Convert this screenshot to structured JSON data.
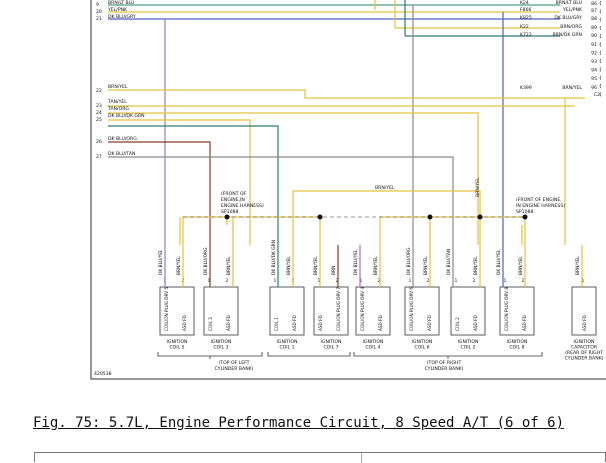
{
  "top_left_rows": [
    {
      "num": "9",
      "label": "BRN/LT BLU"
    },
    {
      "num": "20",
      "label": "YEL/PNK"
    },
    {
      "num": "21",
      "label": "DK BLU/GRY"
    }
  ],
  "left_rows": [
    {
      "num": "22",
      "label": "BRN/YEL"
    },
    {
      "num": "23",
      "label": "TAN/YEL"
    },
    {
      "num": "24",
      "label": "TAN/ORG"
    },
    {
      "num": "25",
      "label": "DK BLU/DK GRN"
    },
    {
      "num": "26",
      "label": "DK BLU/ORG"
    },
    {
      "num": "27",
      "label": "DK BLU/TAN"
    }
  ],
  "right_rows": [
    {
      "code": "K24",
      "label": "BRN/LT BLU",
      "pin": "86"
    },
    {
      "code": "F866",
      "label": "YEL/PNK",
      "pin": "87"
    },
    {
      "code": "K825",
      "label": "DK BLU/GRY",
      "pin": "88"
    },
    {
      "code": "K22",
      "label": "BRN/ORG",
      "pin": "89"
    },
    {
      "code": "K722",
      "label": "BRN/DK GRN",
      "pin": "90"
    }
  ],
  "right_pins_extra": [
    "91",
    "92",
    "93",
    "94",
    "95"
  ],
  "right_brn_yel": {
    "code": "K399",
    "label": "BRN/YEL",
    "pin": "96",
    "connector": "C2"
  },
  "brn_yel_top": "BRN/YEL",
  "brn_yel_vertical": "BRN/YEL",
  "splice_left": [
    "(FRONT OF",
    "ENGINE,IN",
    "ENGINE HARNESS)",
    "SP1088"
  ],
  "splice_right": [
    "(FRONT OF ENGINE,",
    "IN ENGINE HARNESS)",
    "SP1088"
  ],
  "wire_labels": [
    "DK BLU/YEL",
    "BRN/YEL",
    "DK BLU/ORG",
    "BRN/YEL",
    "DK BLU/DK GRN",
    "BRN/YEL",
    "BRN/YEL",
    "BRN",
    "DK BLU/YEL",
    "BRN/YEL",
    "DK BLU/ORG",
    "BRN/YEL",
    "DK BLU/TAN",
    "BRN/YEL",
    "DK BLU/YEL",
    "BRN/YEL",
    "BRN/YEL"
  ],
  "coils": [
    {
      "pins": [
        "COIL/ON PLUG DRV 5",
        "ASD FD"
      ],
      "name": [
        "IGNITION",
        "COIL 5"
      ]
    },
    {
      "pins": [
        "COIL 3",
        "ASD FD"
      ],
      "name": [
        "IGNITION",
        "COIL 3"
      ]
    },
    {
      "pins": [
        "COIL 1",
        "ASD FD"
      ],
      "name": [
        "IGNITION",
        "COIL 1"
      ]
    },
    {
      "pins": [
        "ASD FD",
        "COIL/ON PLUG DRV 7"
      ],
      "name": [
        "IGNITION",
        "COIL 7"
      ]
    },
    {
      "pins": [
        "COIL/ON PLUG DRV 4",
        "ASD FD"
      ],
      "name": [
        "IGNITION",
        "COIL 4"
      ]
    },
    {
      "pins": [
        "COIL/ON PLUG DRV 6",
        "ASD FD"
      ],
      "name": [
        "IGNITION",
        "COIL 6"
      ]
    },
    {
      "pins": [
        "COIL 2",
        "ASD FD"
      ],
      "name": [
        "IGNITION",
        "COIL 2"
      ]
    },
    {
      "pins": [
        "COIL/ON PLUG DRV 8",
        "ASD FD"
      ],
      "name": [
        "IGNITION",
        "COIL 8"
      ]
    },
    {
      "pins": [
        "ASD FD"
      ],
      "name": [
        "IGNITION",
        "CAPACITOR",
        "(REAR OF RIGHT",
        "CYLINDER BANK)"
      ]
    }
  ],
  "bank_left": [
    "(TOP OF LEFT",
    "CYLINDER BANK)"
  ],
  "bank_right": [
    "(TOP OF RIGHT",
    "CYLINDER BANK)"
  ],
  "ref_id": "420538",
  "caption": "Fig. 75: 5.7L, Engine Performance Circuit, 8 Speed A/T (6 of 6)",
  "colors": {
    "yellow": "#e3c23a",
    "brown": "#8c3b2b",
    "green": "#2f7a6e",
    "blue": "#4d62c8",
    "violet": "#9a78c0",
    "gray": "#8a8a8a",
    "border": "#333333"
  }
}
